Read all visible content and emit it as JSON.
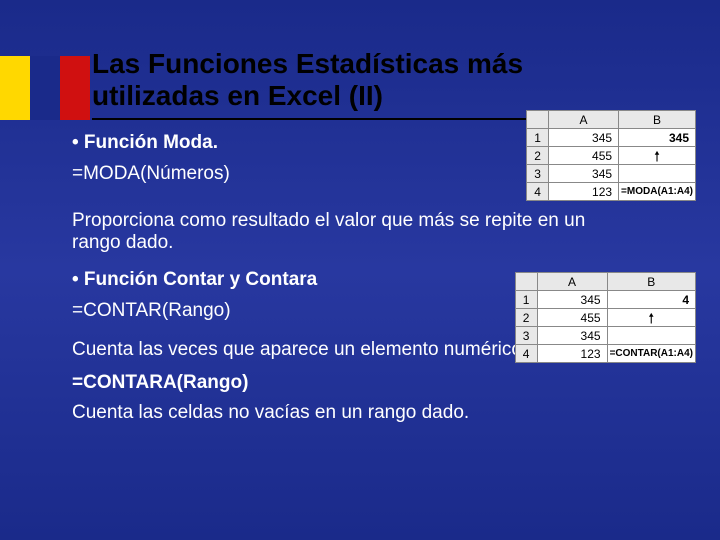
{
  "flag": {
    "colors": [
      "#ffd800",
      "#1a2a8a",
      "#d01010"
    ]
  },
  "title": "Las Funciones Estadísticas más utilizadas en Excel (II)",
  "sections": {
    "moda_bullet": "• Función Moda.",
    "moda_formula": "=MODA(Números)",
    "moda_desc": "Proporciona como resultado el valor que más se repite en un rango dado.",
    "contar_bullet": "• Función Contar y Contara",
    "contar_formula": "=CONTAR(Rango)",
    "contar_desc": "Cuenta las veces que aparece un elemento numérico en una lista.",
    "contara_formula": "=CONTARA(Rango)",
    "contara_desc": "Cuenta las celdas no vacías en un rango dado."
  },
  "table1": {
    "headers": {
      "corner": "",
      "A": "A",
      "B": "B"
    },
    "rows": [
      {
        "n": "1",
        "a": "345",
        "b": "345",
        "b_bold": true
      },
      {
        "n": "2",
        "a": "455",
        "b_arrow": true
      },
      {
        "n": "3",
        "a": "345",
        "b": ""
      },
      {
        "n": "4",
        "a": "123",
        "b": "=MODA(A1:A4)",
        "b_formula": true
      }
    ]
  },
  "table2": {
    "headers": {
      "corner": "",
      "A": "A",
      "B": "B"
    },
    "rows": [
      {
        "n": "1",
        "a": "345",
        "b": "4",
        "b_bold": true
      },
      {
        "n": "2",
        "a": "455",
        "b_arrow": true
      },
      {
        "n": "3",
        "a": "345",
        "b": ""
      },
      {
        "n": "4",
        "a": "123",
        "b": "=CONTAR(A1:A4)",
        "b_formula": true
      }
    ]
  }
}
